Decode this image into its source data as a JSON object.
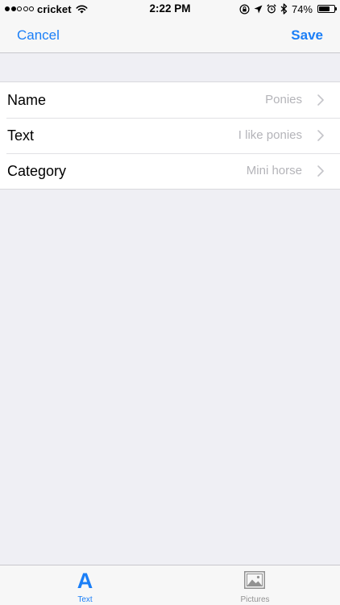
{
  "status_bar": {
    "carrier": "cricket",
    "signal_bars_total": 5,
    "signal_bars_filled": 2,
    "time": "2:22 PM",
    "battery_percent_text": "74%",
    "battery_level": 0.74,
    "icons": [
      "wifi-icon",
      "orientation-lock-icon",
      "location-arrow-icon",
      "alarm-clock-icon",
      "bluetooth-icon",
      "battery-icon"
    ]
  },
  "nav": {
    "cancel_label": "Cancel",
    "save_label": "Save"
  },
  "rows": [
    {
      "label": "Name",
      "value": "Ponies"
    },
    {
      "label": "Text",
      "value": "I like ponies"
    },
    {
      "label": "Category",
      "value": "Mini horse"
    }
  ],
  "tabs": [
    {
      "label": "Text",
      "icon": "letter-a-icon",
      "glyph": "A",
      "active": true
    },
    {
      "label": "Pictures",
      "icon": "picture-icon",
      "active": false
    }
  ],
  "colors": {
    "accent": "#1b7ff7",
    "background": "#efeff4",
    "secondary_text": "#b4b4b9",
    "inactive_tab": "#929292"
  }
}
